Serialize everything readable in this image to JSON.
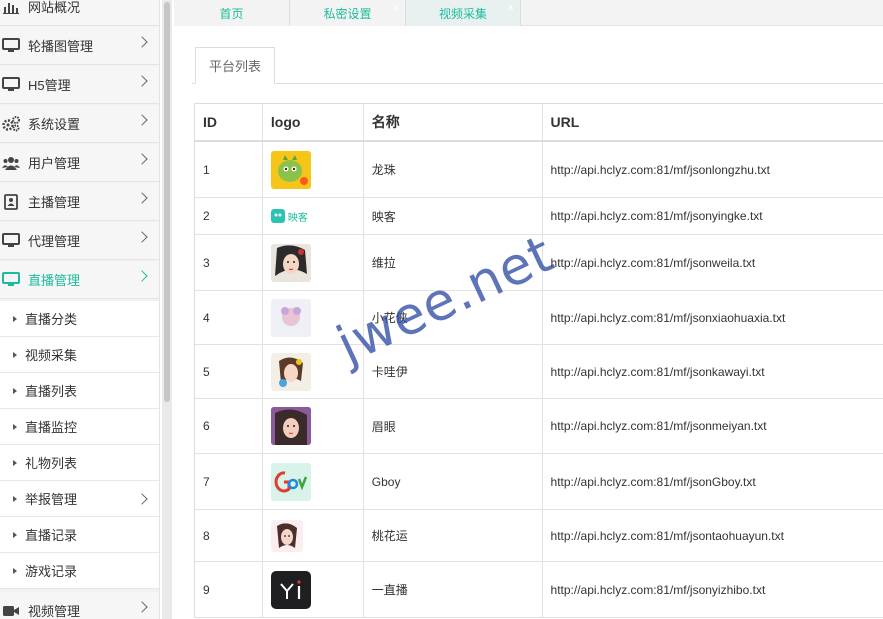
{
  "sidebar": {
    "menu": [
      {
        "label": "网站概况",
        "icon": "bar-chart-icon"
      },
      {
        "label": "轮播图管理",
        "icon": "monitor-icon"
      },
      {
        "label": "H5管理",
        "icon": "monitor-icon"
      },
      {
        "label": "系统设置",
        "icon": "gears-icon"
      },
      {
        "label": "用户管理",
        "icon": "users-icon"
      },
      {
        "label": "主播管理",
        "icon": "id-card-icon"
      },
      {
        "label": "代理管理",
        "icon": "monitor-icon"
      },
      {
        "label": "直播管理",
        "icon": "monitor-icon"
      }
    ],
    "sub": [
      {
        "label": "直播分类"
      },
      {
        "label": "视频采集"
      },
      {
        "label": "直播列表"
      },
      {
        "label": "直播监控"
      },
      {
        "label": "礼物列表"
      },
      {
        "label": "举报管理"
      },
      {
        "label": "直播记录"
      },
      {
        "label": "游戏记录"
      }
    ],
    "bottom": {
      "label": "视频管理",
      "icon": "video-camera-icon"
    }
  },
  "tabs": [
    {
      "label": "首页"
    },
    {
      "label": "私密设置",
      "close": "×"
    },
    {
      "label": "视频采集",
      "close": "×"
    }
  ],
  "subtab": "平台列表",
  "table": {
    "headers": [
      "ID",
      "logo",
      "名称",
      "URL"
    ],
    "rows": [
      {
        "id": "1",
        "name": "龙珠",
        "url": "http://api.hclyz.com:81/mf/jsonlongzhu.txt"
      },
      {
        "id": "2",
        "name": "映客",
        "url": "http://api.hclyz.com:81/mf/jsonyingke.txt",
        "logo_text": "映客"
      },
      {
        "id": "3",
        "name": "维拉",
        "url": "http://api.hclyz.com:81/mf/jsonweila.txt"
      },
      {
        "id": "4",
        "name": "小花侠",
        "url": "http://api.hclyz.com:81/mf/jsonxiaohuaxia.txt"
      },
      {
        "id": "5",
        "name": "卡哇伊",
        "url": "http://api.hclyz.com:81/mf/jsonkawayi.txt"
      },
      {
        "id": "6",
        "name": "眉眼",
        "url": "http://api.hclyz.com:81/mf/jsonmeiyan.txt"
      },
      {
        "id": "7",
        "name": "Gboy",
        "url": "http://api.hclyz.com:81/mf/jsonGboy.txt"
      },
      {
        "id": "8",
        "name": "桃花运",
        "url": "http://api.hclyz.com:81/mf/jsontaohuayun.txt"
      },
      {
        "id": "9",
        "name": "一直播",
        "url": "http://api.hclyz.com:81/mf/jsonyizhibo.txt"
      }
    ]
  },
  "watermark": "jwee.net",
  "colors": {
    "accent": "#1bbc9b"
  }
}
